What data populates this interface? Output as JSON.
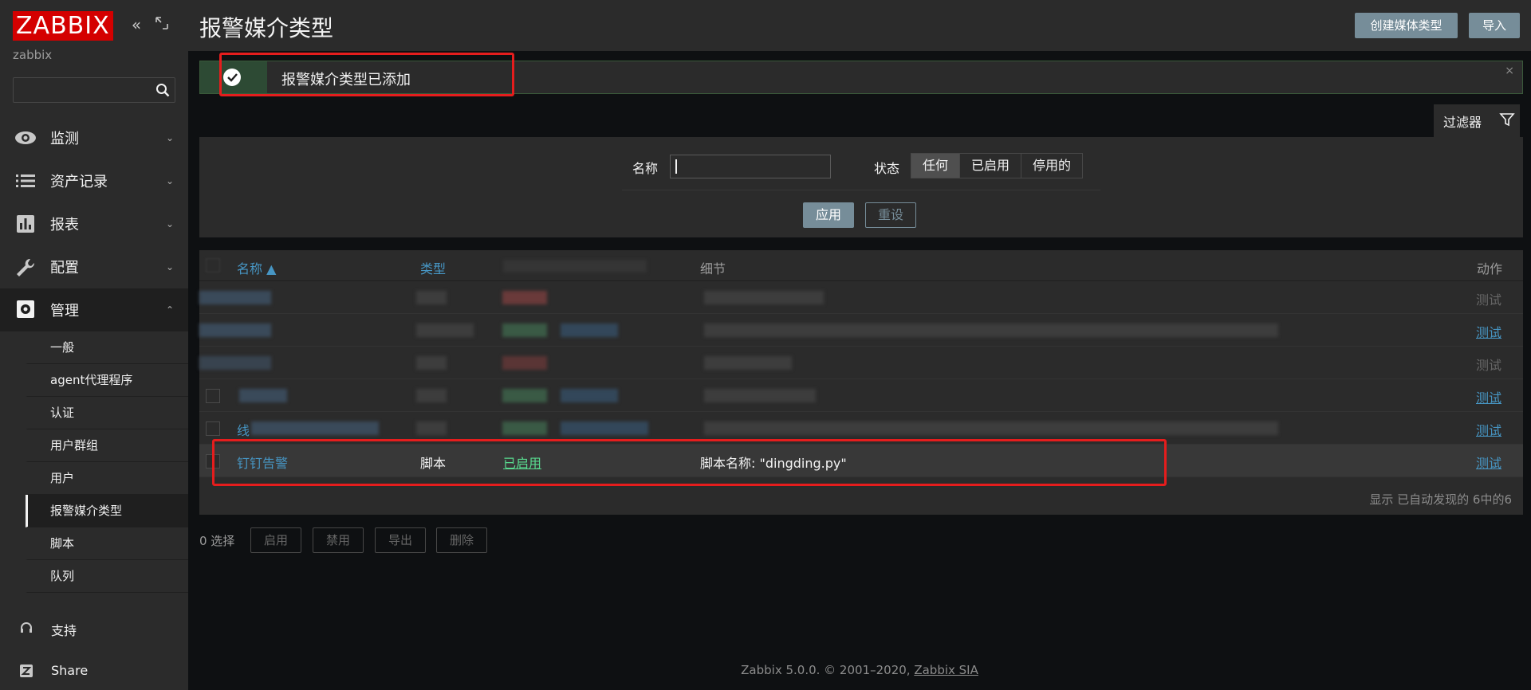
{
  "sidebar": {
    "logo": "ZABBIX",
    "user": "zabbix",
    "menu": [
      {
        "label": "监测"
      },
      {
        "label": "资产记录"
      },
      {
        "label": "报表"
      },
      {
        "label": "配置"
      },
      {
        "label": "管理"
      }
    ],
    "admin_submenu": [
      "一般",
      "agent代理程序",
      "认证",
      "用户群组",
      "用户",
      "报警媒介类型",
      "脚本",
      "队列"
    ],
    "bottom": [
      {
        "label": "支持"
      },
      {
        "label": "Share"
      }
    ]
  },
  "header": {
    "title": "报警媒介类型",
    "create_button": "创建媒体类型",
    "import_button": "导入"
  },
  "message": {
    "text": "报警媒介类型已添加",
    "close": "×"
  },
  "filter": {
    "tab_label": "过滤器",
    "name_label": "名称",
    "name_value": "",
    "status_label": "状态",
    "status_options": [
      "任何",
      "已启用",
      "停用的"
    ],
    "status_selected": "任何",
    "apply": "应用",
    "reset": "重设"
  },
  "table": {
    "headers": {
      "name": "名称 ▲",
      "type": "类型",
      "details": "细节",
      "actions": "动作"
    },
    "test_label": "测试",
    "row_new": {
      "name": "钉钉告警",
      "type": "脚本",
      "status": "已启用",
      "details": "脚本名称: \"dingding.py\""
    },
    "row5_name_fragment": "线",
    "footer": "显示 已自动发现的 6中的6"
  },
  "actions": {
    "selected": "0 选择",
    "enable": "启用",
    "disable": "禁用",
    "export": "导出",
    "delete": "删除"
  },
  "footer": {
    "text": "Zabbix 5.0.0. © 2001–2020, ",
    "link": "Zabbix SIA"
  }
}
